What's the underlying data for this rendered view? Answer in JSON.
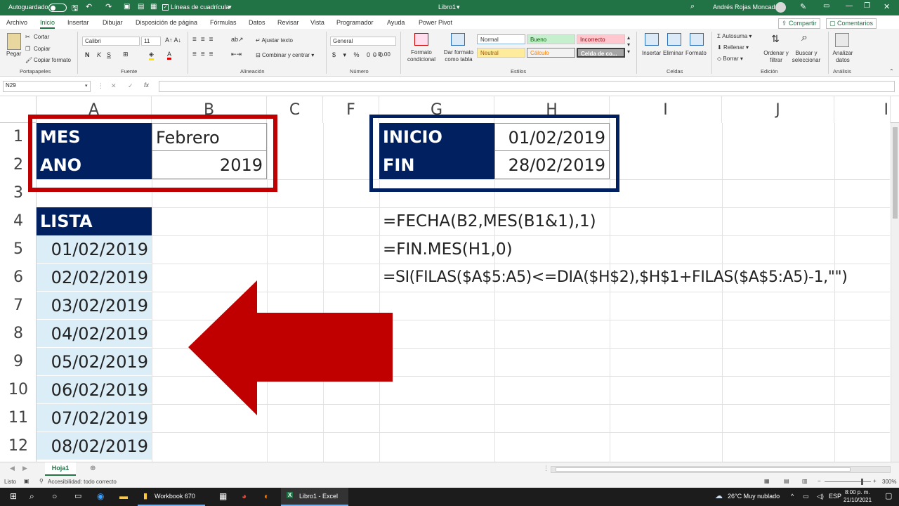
{
  "titlebar": {
    "autosave": "Autoguardado",
    "gridlines": "Líneas de cuadrícula",
    "doc_title": "Libro1",
    "user": "Andrés Rojas Moncada"
  },
  "tabs": [
    "Archivo",
    "Inicio",
    "Insertar",
    "Dibujar",
    "Disposición de página",
    "Fórmulas",
    "Datos",
    "Revisar",
    "Vista",
    "Programador",
    "Ayuda",
    "Power Pivot"
  ],
  "share": "Compartir",
  "comments": "Comentarios",
  "ribbon": {
    "paste": "Pegar",
    "cut": "Cortar",
    "copy": "Copiar",
    "format_painter": "Copiar formato",
    "g_clipboard": "Portapapeles",
    "font_name": "Calibri",
    "font_size": "11",
    "g_font": "Fuente",
    "wrap": "Ajustar texto",
    "merge": "Combinar y centrar",
    "g_align": "Alineación",
    "num_format": "General",
    "g_number": "Número",
    "cond_format": "Formato condicional",
    "table_format": "Dar formato como tabla",
    "styles": [
      "Normal",
      "Bueno",
      "Incorrecto",
      "Neutral",
      "Cálculo",
      "Celda de co..."
    ],
    "g_styles": "Estilos",
    "insert": "Insertar",
    "delete": "Eliminar",
    "format": "Formato",
    "g_cells": "Celdas",
    "autosum": "Autosuma",
    "fill": "Rellenar",
    "clear": "Borrar",
    "sort": "Ordenar y filtrar",
    "find": "Buscar y seleccionar",
    "g_edit": "Edición",
    "analyze": "Analizar datos",
    "g_analysis": "Análisis"
  },
  "namebox": "N29",
  "columns": [
    "A",
    "B",
    "C",
    "F",
    "G",
    "H",
    "I",
    "J",
    "I"
  ],
  "rows": [
    "1",
    "2",
    "3",
    "4",
    "5",
    "6",
    "7",
    "8",
    "9",
    "10",
    "11",
    "12"
  ],
  "cells": {
    "a1": "MES",
    "b1": "Febrero",
    "a2": "ANO",
    "b2": "2019",
    "g1": "INICIO",
    "h1": "01/02/2019",
    "g2": "FIN",
    "h2": "28/02/2019",
    "a4": "LISTA",
    "list": [
      "01/02/2019",
      "02/02/2019",
      "03/02/2019",
      "04/02/2019",
      "05/02/2019",
      "06/02/2019",
      "07/02/2019",
      "08/02/2019"
    ],
    "g4": "=FECHA(B2,MES(B1&1),1)",
    "g5": "=FIN.MES(H1,0)",
    "g6": "=SI(FILAS($A$5:A5)<=DIA($H$2),$H$1+FILAS($A$5:A5)-1,\"\")"
  },
  "sheet_tab": "Hoja1",
  "status": {
    "ready": "Listo",
    "accessibility": "Accesibilidad: todo correcto",
    "zoom": "300%"
  },
  "taskbar": {
    "app1": "Workbook 670",
    "app2": "Libro1 - Excel",
    "weather": "26°C  Muy nublado",
    "lang": "ESP",
    "time": "8:00 p. m.",
    "date": "21/10/2021"
  },
  "colors": {
    "excel_green": "#217346",
    "navy": "#002060",
    "red": "#c00000",
    "light_blue": "#dbeef8"
  }
}
